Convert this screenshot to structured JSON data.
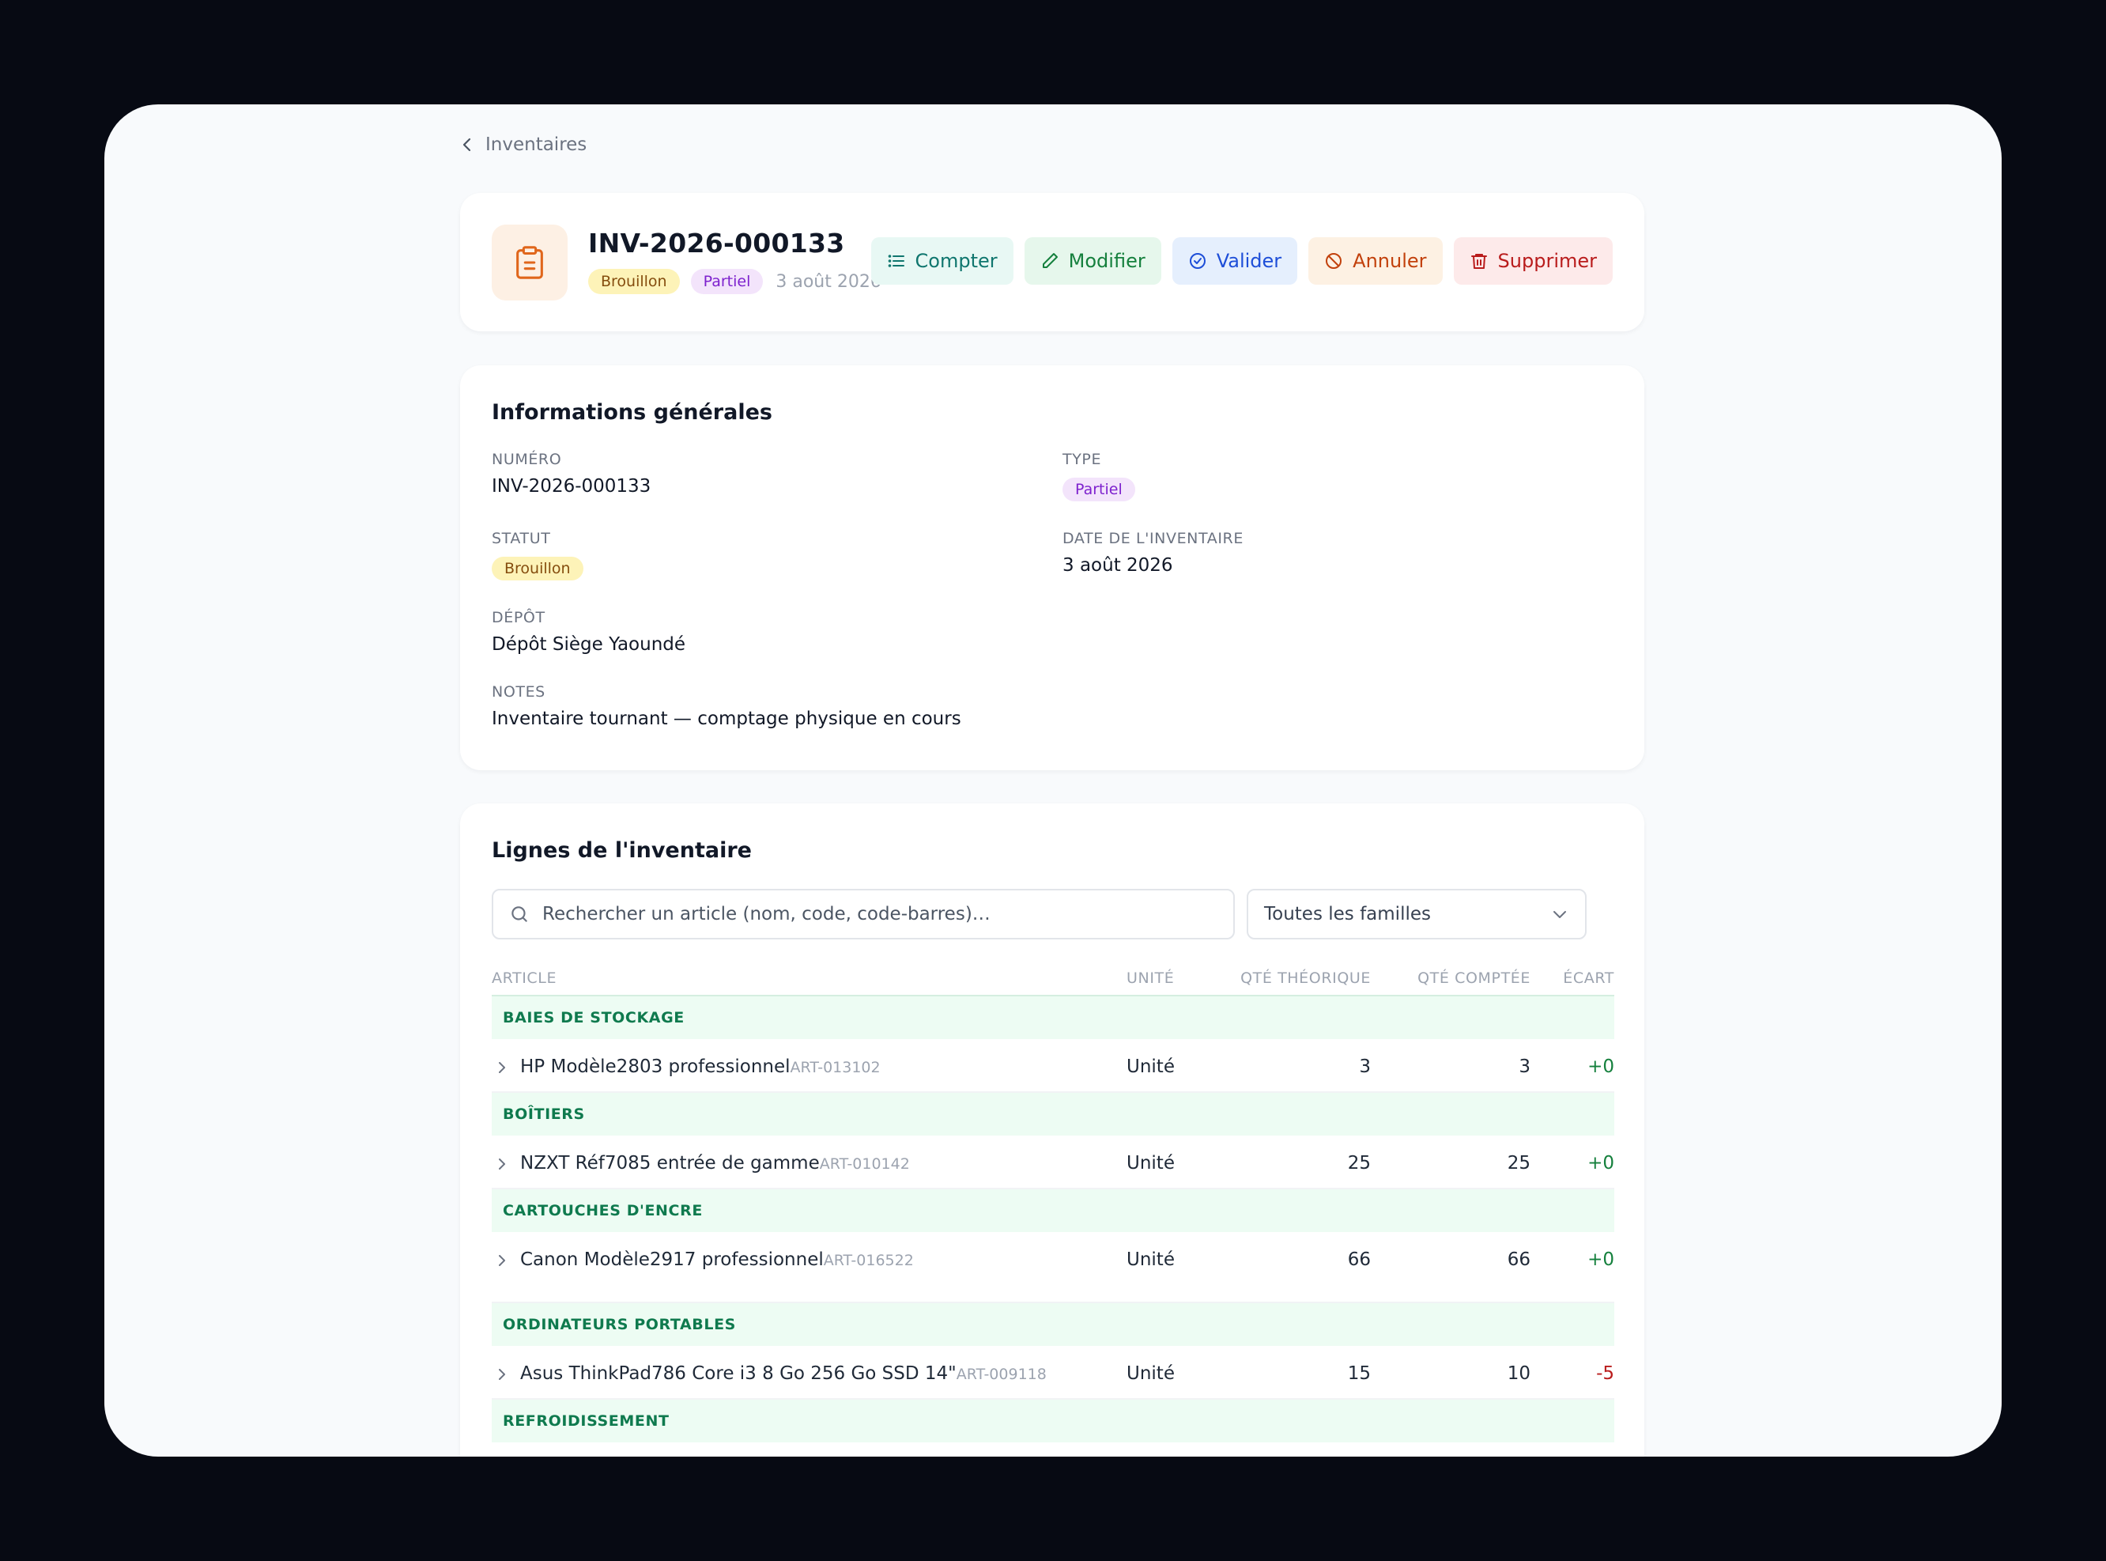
{
  "breadcrumb": {
    "label": "Inventaires"
  },
  "header": {
    "title": "INV-2026-000133",
    "status_badge": "Brouillon",
    "type_badge": "Partiel",
    "date": "3 août 2026",
    "icon": "clipboard-icon"
  },
  "actions": {
    "count": "Compter",
    "edit": "Modifier",
    "validate": "Valider",
    "cancel": "Annuler",
    "delete": "Supprimer"
  },
  "info": {
    "title": "Informations générales",
    "numero_label": "NUMÉRO",
    "numero_value": "INV-2026-000133",
    "type_label": "TYPE",
    "type_value": "Partiel",
    "statut_label": "STATUT",
    "statut_value": "Brouillon",
    "date_label": "DATE DE L'INVENTAIRE",
    "date_value": "3 août 2026",
    "depot_label": "DÉPÔT",
    "depot_value": "Dépôt Siège Yaoundé",
    "notes_label": "NOTES",
    "notes_value": "Inventaire tournant — comptage physique en cours"
  },
  "lines": {
    "title": "Lignes de l'inventaire",
    "search_placeholder": "Rechercher un article (nom, code, code-barres)…",
    "family_filter": "Toutes les familles",
    "columns": {
      "article": "ARTICLE",
      "unit": "UNITÉ",
      "theoretical": "QTÉ THÉORIQUE",
      "counted": "QTÉ COMPTÉE",
      "gap": "ÉCART"
    },
    "groups": [
      {
        "name": "BAIES DE STOCKAGE",
        "item": {
          "name": "HP Modèle2803 professionnel",
          "code": "ART-013102",
          "unit": "Unité",
          "theoretical": "3",
          "counted": "3",
          "gap": "+0"
        }
      },
      {
        "name": "BOÎTIERS",
        "item": {
          "name": "NZXT Réf7085 entrée de gamme",
          "code": "ART-010142",
          "unit": "Unité",
          "theoretical": "25",
          "counted": "25",
          "gap": "+0"
        }
      },
      {
        "name": "CARTOUCHES D'ENCRE",
        "item": {
          "name": "Canon Modèle2917 professionnel",
          "code": "ART-016522",
          "unit": "Unité",
          "theoretical": "66",
          "counted": "66",
          "gap": "+0"
        }
      },
      {
        "name": "ORDINATEURS PORTABLES",
        "item": {
          "name": "Asus ThinkPad786 Core i3 8 Go 256 Go SSD 14\"",
          "code": "ART-009118",
          "unit": "Unité",
          "theoretical": "15",
          "counted": "10",
          "gap": "-5"
        }
      },
      {
        "name": "REFROIDISSEMENT"
      }
    ]
  }
}
